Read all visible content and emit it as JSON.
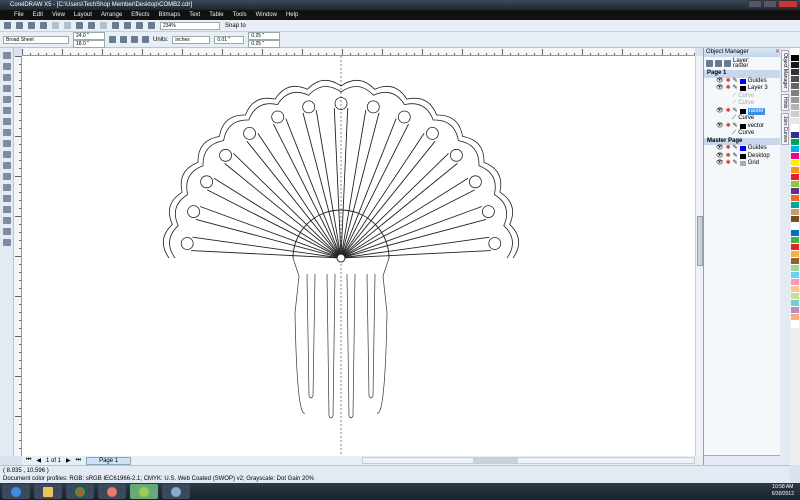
{
  "title": "CorelDRAW X5 - [C:\\Users\\TechShop Member\\Desktop\\COMB2.cdr]",
  "menu": [
    "File",
    "Edit",
    "View",
    "Layout",
    "Arrange",
    "Effects",
    "Bitmaps",
    "Text",
    "Table",
    "Tools",
    "Window",
    "Help"
  ],
  "toolbar": {
    "zoom": "234%",
    "snap_to": "Snap to"
  },
  "propbar": {
    "paper": "Broad Sheet",
    "width": "24.0 \"",
    "height": "18.0 \"",
    "units_label": "Units:",
    "units": "inches",
    "nudge": "0.01 \"",
    "dup_x": "0.25 \"",
    "dup_y": "0.25 \""
  },
  "pagenav": {
    "count": "1 of 1",
    "tab": "Page 1"
  },
  "status": {
    "coords": "( 8.935 , 10.596 )",
    "profiles": "Document color profiles: RGB: sRGB IEC61966-2.1; CMYK: U.S. Web Coated (SWOP) v2; Grayscale: Dot Gain 20%"
  },
  "object_manager": {
    "title": "Object Manager",
    "layer_label": "Layer:",
    "layer_value": "raster",
    "rows": [
      {
        "kind": "page",
        "label": "Page 1"
      },
      {
        "kind": "layer",
        "label": "Guides",
        "color": "#0000ff"
      },
      {
        "kind": "layer",
        "label": "Layer 3",
        "color": "#000000"
      },
      {
        "kind": "obj",
        "label": "Curve",
        "dim": true
      },
      {
        "kind": "obj",
        "label": "Curve",
        "dim": true
      },
      {
        "kind": "layer",
        "label": "raster",
        "color": "#000000",
        "selected": true
      },
      {
        "kind": "obj",
        "label": "Curve"
      },
      {
        "kind": "layer",
        "label": "vector",
        "color": "#000000"
      },
      {
        "kind": "obj",
        "label": "Curve"
      },
      {
        "kind": "page",
        "label": "Master Page"
      },
      {
        "kind": "layer",
        "label": "Guides",
        "color": "#0000ff"
      },
      {
        "kind": "layer",
        "label": "Desktop",
        "color": "#000000"
      },
      {
        "kind": "layer",
        "label": "Grid",
        "color": "#aaaaaa"
      }
    ]
  },
  "side_tabs": [
    "Object Manager",
    "Hints",
    "Join Curves"
  ],
  "palette": [
    "#ffffff",
    "#000000",
    "#1a1a1a",
    "#333333",
    "#4d4d4d",
    "#666666",
    "#808080",
    "#999999",
    "#b3b3b3",
    "#cccccc",
    "#e6e6e6",
    "#ffffff",
    "#2e3192",
    "#00a651",
    "#00aeef",
    "#ec008c",
    "#fff200",
    "#f7941d",
    "#ed1c24",
    "#8dc63f",
    "#662d91",
    "#f26522",
    "#00a99d",
    "#c69c6d",
    "#754c24",
    "#ffffff",
    "#0072bc",
    "#39b54a",
    "#ee1d23",
    "#fbaf3f",
    "#8c6239",
    "#a3d39c",
    "#6dcff6",
    "#f49ac1",
    "#fdc689",
    "#c4df9b",
    "#7accc8",
    "#bd8cbf",
    "#f9ad81",
    "#ffffff"
  ],
  "clock": {
    "time": "10:58 AM",
    "date": "6/30/2012"
  }
}
